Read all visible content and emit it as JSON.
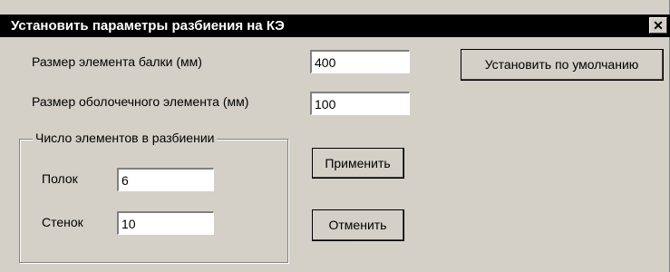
{
  "window": {
    "title": "Установить параметры разбиения на КЭ",
    "close_glyph": "✕"
  },
  "form": {
    "beam_element_label": "Размер элемента балки (мм)",
    "beam_element_value": "400",
    "shell_element_label": "Размер оболочечного элемента  (мм)",
    "shell_element_value": "100",
    "group_title": "Число элементов в разбиении",
    "flanges_label": "Полок",
    "flanges_value": "6",
    "webs_label": "Стенок",
    "webs_value": "10"
  },
  "buttons": {
    "defaults": "Установить по умолчанию",
    "apply": "Применить",
    "cancel": "Отменить"
  }
}
